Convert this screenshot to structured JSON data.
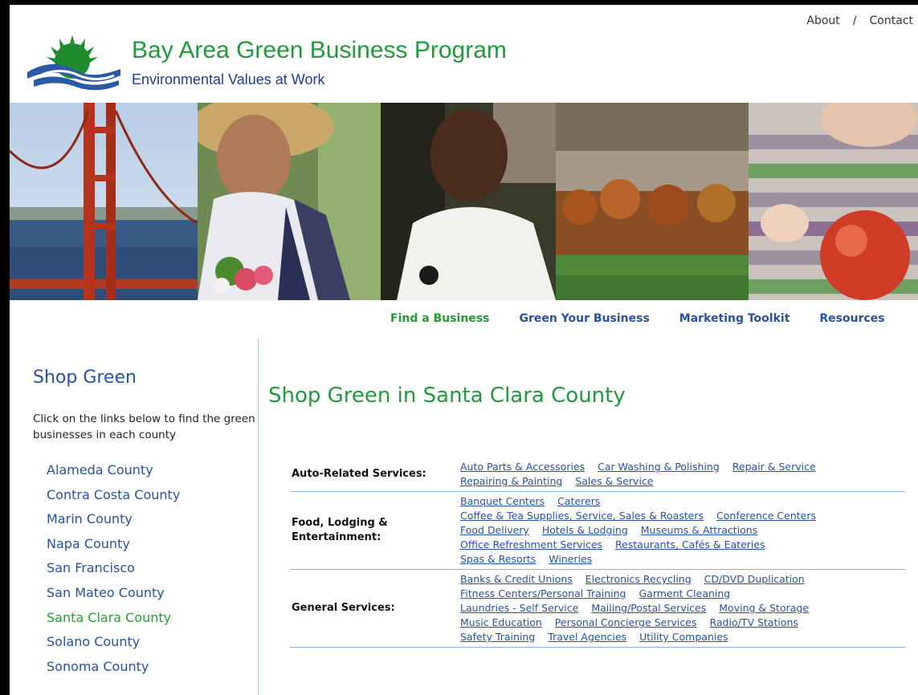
{
  "header": {
    "about": "About",
    "separator": "/",
    "contact": "Contact",
    "title": "Bay Area Green Business Program",
    "tagline": "Environmental Values at Work"
  },
  "banner": {
    "photos": [
      "golden-gate-bridge-photo",
      "woman-with-flowers-photo",
      "chef-photo",
      "vineyard-photo",
      "child-with-apple-photo"
    ]
  },
  "nav": {
    "find": "Find a Business",
    "green": "Green Your Business",
    "toolkit": "Marketing Toolkit",
    "resources": "Resources"
  },
  "sidebar": {
    "title": "Shop Green",
    "intro": "Click on the links below to find the green businesses in each county",
    "counties": [
      "Alameda County",
      "Contra Costa County",
      "Marin County",
      "Napa County",
      "San Francisco",
      "San Mateo County",
      "Santa Clara County",
      "Solano County",
      "Sonoma County"
    ],
    "active_county": "Santa Clara County"
  },
  "main": {
    "title": "Shop Green in Santa Clara County",
    "categories": [
      {
        "label_lines": [
          "Auto-Related Services:"
        ],
        "link_lines": [
          [
            "Auto Parts & Accessories",
            "Car Washing & Polishing",
            "Repair & Service"
          ],
          [
            "Repairing & Painting",
            "Sales & Service"
          ]
        ]
      },
      {
        "label_lines": [
          "Food, Lodging &",
          "Entertainment:"
        ],
        "link_lines": [
          [
            "Banquet Centers",
            "Caterers"
          ],
          [
            "Coffee & Tea Supplies, Service, Sales & Roasters",
            "Conference Centers"
          ],
          [
            "Food Delivery",
            "Hotels & Lodging",
            "Museums & Attractions"
          ],
          [
            "Office Refreshment Services",
            "Restaurants, Cafés & Eateries"
          ],
          [
            "Spas & Resorts",
            "Wineries"
          ]
        ]
      },
      {
        "label_lines": [
          "General Services:"
        ],
        "link_lines": [
          [
            "Banks & Credit Unions",
            "Electronics Recycling",
            "CD/DVD Duplication"
          ],
          [
            "Fitness Centers/Personal Training",
            "Garment Cleaning"
          ],
          [
            "Laundries - Self Service",
            "Mailing/Postal Services",
            "Moving & Storage"
          ],
          [
            "Music Education",
            "Personal Concierge Services",
            "Radio/TV Stations"
          ],
          [
            "Safety Training",
            "Travel Agencies",
            "Utility Companies"
          ]
        ]
      }
    ]
  },
  "colors": {
    "brand_green": "#1e9b3a",
    "link_blue": "#2452a6",
    "divider_blue": "#8bb6e6"
  }
}
